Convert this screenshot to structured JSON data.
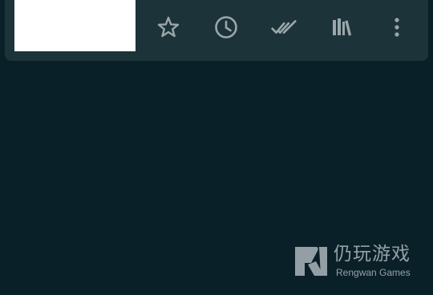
{
  "toolbar": {
    "thumbnail": "white-thumbnail-image",
    "buttons": [
      {
        "icon": "star-outline-icon"
      },
      {
        "icon": "clock-icon"
      },
      {
        "icon": "double-check-icon"
      },
      {
        "icon": "books-icon"
      },
      {
        "icon": "more-vertical-icon"
      }
    ],
    "icon_color": "#9aa6aa"
  },
  "watermark": {
    "logo_icon": "rengwan-logo",
    "cn_text": "仍玩游戏",
    "en_text": "Rengwan Games"
  },
  "colors": {
    "background": "#0a2028",
    "toolbar": "#1c3339",
    "watermark_text": "#e8eef0"
  }
}
